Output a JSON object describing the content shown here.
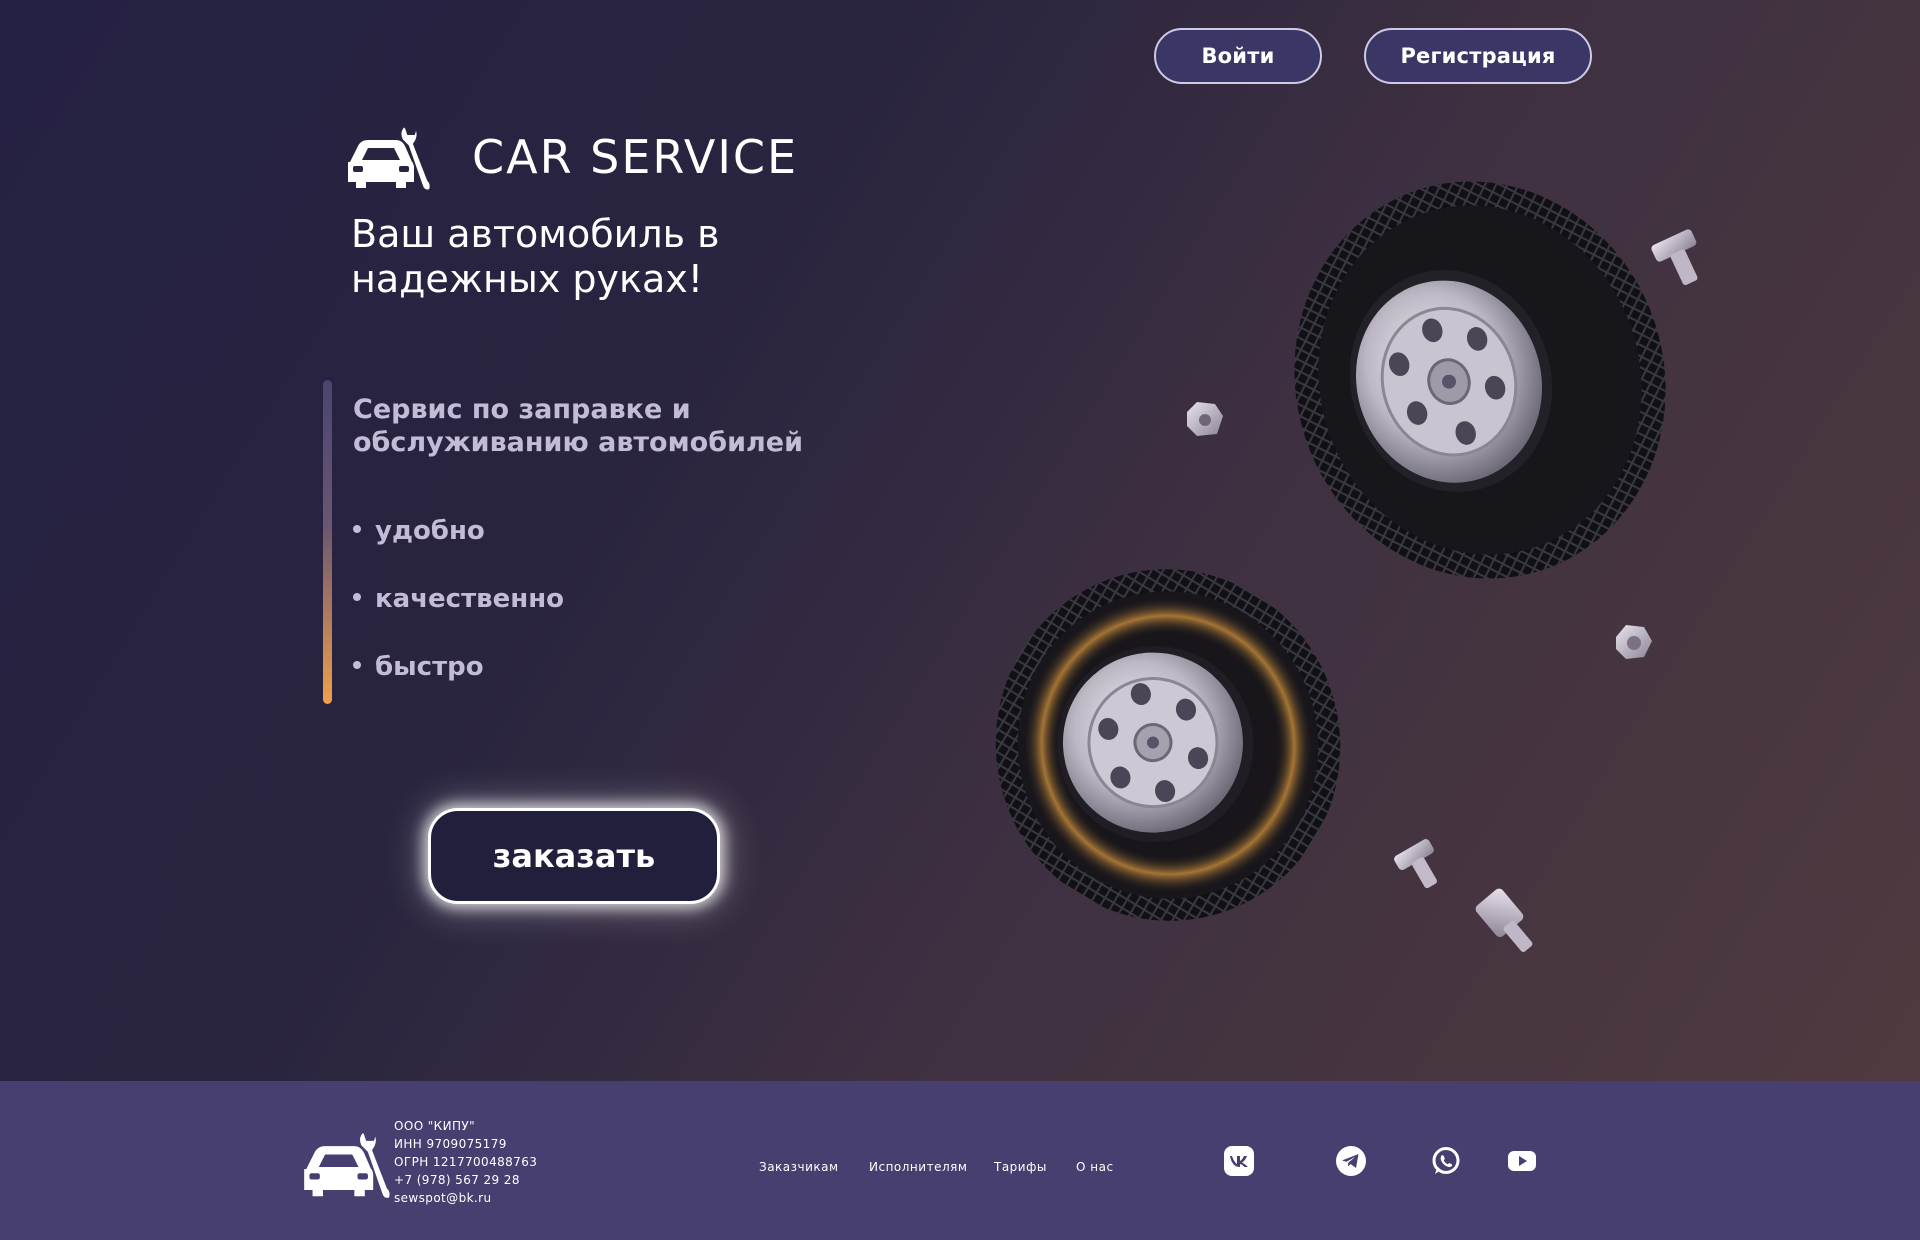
{
  "header": {
    "login_label": "Войти",
    "register_label": "Регистрация"
  },
  "brand": {
    "name": "CAR SERVICE",
    "logo_icon": "car-wrench-icon"
  },
  "hero": {
    "tagline_line1": "Ваш автомобиль в",
    "tagline_line2": "надежных руках!",
    "description_line1": "Сервис по заправке и",
    "description_line2": "обслуживанию автомобилей",
    "features": [
      "удобно",
      "качественно",
      "быстро"
    ],
    "order_label": "заказать"
  },
  "footer": {
    "company": [
      "ООО \"КИПУ\"",
      "ИНН 9709075179",
      "ОГРН 1217700488763",
      "+7 (978) 567 29 28",
      "sewspot@bk.ru"
    ],
    "nav": [
      "Заказчикам",
      "Исполнителям",
      "Тарифы",
      "О нас"
    ],
    "social_icons": [
      "vk-icon",
      "telegram-icon",
      "whatsapp-icon",
      "youtube-icon"
    ]
  },
  "colors": {
    "hero_bg_start": "#252142",
    "hero_bg_end": "#4f3a3f",
    "footer_bg": "#463f70",
    "button_bg": "#3a3766",
    "accent_orange": "#f0a04a",
    "muted_text": "#c4bcd6"
  }
}
